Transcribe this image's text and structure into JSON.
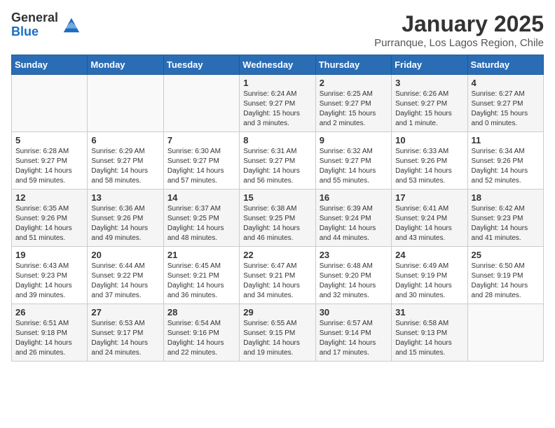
{
  "header": {
    "logo_general": "General",
    "logo_blue": "Blue",
    "month_title": "January 2025",
    "subtitle": "Purranque, Los Lagos Region, Chile"
  },
  "days_of_week": [
    "Sunday",
    "Monday",
    "Tuesday",
    "Wednesday",
    "Thursday",
    "Friday",
    "Saturday"
  ],
  "weeks": [
    [
      {
        "day": "",
        "info": ""
      },
      {
        "day": "",
        "info": ""
      },
      {
        "day": "",
        "info": ""
      },
      {
        "day": "1",
        "info": "Sunrise: 6:24 AM\nSunset: 9:27 PM\nDaylight: 15 hours and 3 minutes."
      },
      {
        "day": "2",
        "info": "Sunrise: 6:25 AM\nSunset: 9:27 PM\nDaylight: 15 hours and 2 minutes."
      },
      {
        "day": "3",
        "info": "Sunrise: 6:26 AM\nSunset: 9:27 PM\nDaylight: 15 hours and 1 minute."
      },
      {
        "day": "4",
        "info": "Sunrise: 6:27 AM\nSunset: 9:27 PM\nDaylight: 15 hours and 0 minutes."
      }
    ],
    [
      {
        "day": "5",
        "info": "Sunrise: 6:28 AM\nSunset: 9:27 PM\nDaylight: 14 hours and 59 minutes."
      },
      {
        "day": "6",
        "info": "Sunrise: 6:29 AM\nSunset: 9:27 PM\nDaylight: 14 hours and 58 minutes."
      },
      {
        "day": "7",
        "info": "Sunrise: 6:30 AM\nSunset: 9:27 PM\nDaylight: 14 hours and 57 minutes."
      },
      {
        "day": "8",
        "info": "Sunrise: 6:31 AM\nSunset: 9:27 PM\nDaylight: 14 hours and 56 minutes."
      },
      {
        "day": "9",
        "info": "Sunrise: 6:32 AM\nSunset: 9:27 PM\nDaylight: 14 hours and 55 minutes."
      },
      {
        "day": "10",
        "info": "Sunrise: 6:33 AM\nSunset: 9:26 PM\nDaylight: 14 hours and 53 minutes."
      },
      {
        "day": "11",
        "info": "Sunrise: 6:34 AM\nSunset: 9:26 PM\nDaylight: 14 hours and 52 minutes."
      }
    ],
    [
      {
        "day": "12",
        "info": "Sunrise: 6:35 AM\nSunset: 9:26 PM\nDaylight: 14 hours and 51 minutes."
      },
      {
        "day": "13",
        "info": "Sunrise: 6:36 AM\nSunset: 9:26 PM\nDaylight: 14 hours and 49 minutes."
      },
      {
        "day": "14",
        "info": "Sunrise: 6:37 AM\nSunset: 9:25 PM\nDaylight: 14 hours and 48 minutes."
      },
      {
        "day": "15",
        "info": "Sunrise: 6:38 AM\nSunset: 9:25 PM\nDaylight: 14 hours and 46 minutes."
      },
      {
        "day": "16",
        "info": "Sunrise: 6:39 AM\nSunset: 9:24 PM\nDaylight: 14 hours and 44 minutes."
      },
      {
        "day": "17",
        "info": "Sunrise: 6:41 AM\nSunset: 9:24 PM\nDaylight: 14 hours and 43 minutes."
      },
      {
        "day": "18",
        "info": "Sunrise: 6:42 AM\nSunset: 9:23 PM\nDaylight: 14 hours and 41 minutes."
      }
    ],
    [
      {
        "day": "19",
        "info": "Sunrise: 6:43 AM\nSunset: 9:23 PM\nDaylight: 14 hours and 39 minutes."
      },
      {
        "day": "20",
        "info": "Sunrise: 6:44 AM\nSunset: 9:22 PM\nDaylight: 14 hours and 37 minutes."
      },
      {
        "day": "21",
        "info": "Sunrise: 6:45 AM\nSunset: 9:21 PM\nDaylight: 14 hours and 36 minutes."
      },
      {
        "day": "22",
        "info": "Sunrise: 6:47 AM\nSunset: 9:21 PM\nDaylight: 14 hours and 34 minutes."
      },
      {
        "day": "23",
        "info": "Sunrise: 6:48 AM\nSunset: 9:20 PM\nDaylight: 14 hours and 32 minutes."
      },
      {
        "day": "24",
        "info": "Sunrise: 6:49 AM\nSunset: 9:19 PM\nDaylight: 14 hours and 30 minutes."
      },
      {
        "day": "25",
        "info": "Sunrise: 6:50 AM\nSunset: 9:19 PM\nDaylight: 14 hours and 28 minutes."
      }
    ],
    [
      {
        "day": "26",
        "info": "Sunrise: 6:51 AM\nSunset: 9:18 PM\nDaylight: 14 hours and 26 minutes."
      },
      {
        "day": "27",
        "info": "Sunrise: 6:53 AM\nSunset: 9:17 PM\nDaylight: 14 hours and 24 minutes."
      },
      {
        "day": "28",
        "info": "Sunrise: 6:54 AM\nSunset: 9:16 PM\nDaylight: 14 hours and 22 minutes."
      },
      {
        "day": "29",
        "info": "Sunrise: 6:55 AM\nSunset: 9:15 PM\nDaylight: 14 hours and 19 minutes."
      },
      {
        "day": "30",
        "info": "Sunrise: 6:57 AM\nSunset: 9:14 PM\nDaylight: 14 hours and 17 minutes."
      },
      {
        "day": "31",
        "info": "Sunrise: 6:58 AM\nSunset: 9:13 PM\nDaylight: 14 hours and 15 minutes."
      },
      {
        "day": "",
        "info": ""
      }
    ]
  ]
}
